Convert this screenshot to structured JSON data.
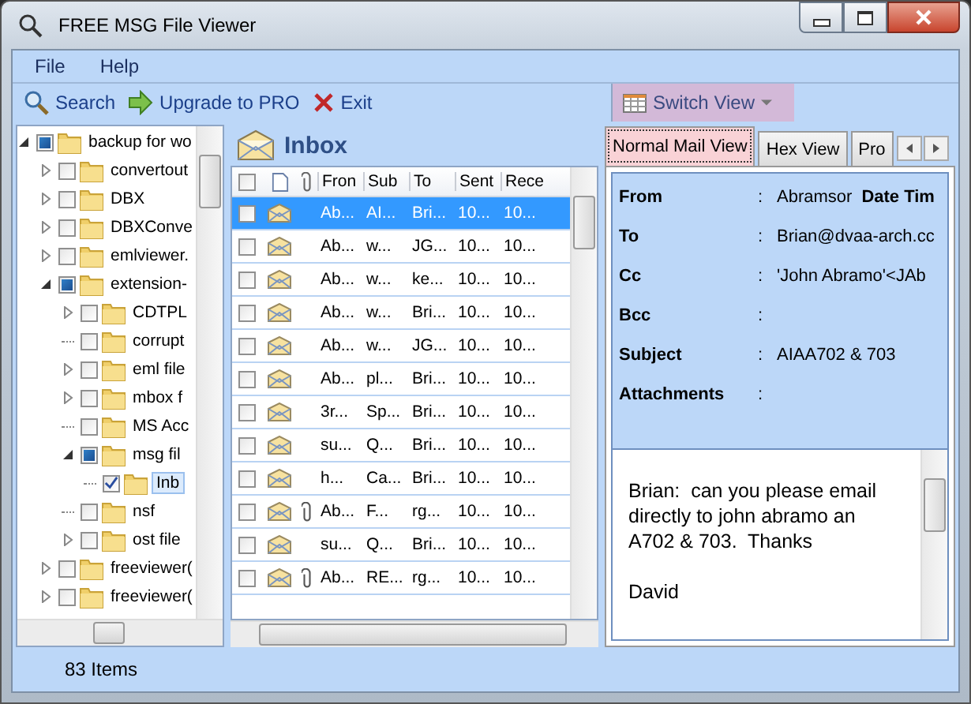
{
  "window": {
    "title": "FREE MSG File Viewer"
  },
  "menu": [
    "File",
    "Help"
  ],
  "toolbar": [
    {
      "kind": "search",
      "label": "Search",
      "highlighted": false
    },
    {
      "kind": "upgrade",
      "label": "Upgrade to PRO",
      "highlighted": false
    },
    {
      "kind": "exit",
      "label": "Exit",
      "highlighted": false
    },
    {
      "kind": "switch",
      "label": "Switch View",
      "highlighted": true
    }
  ],
  "tree": {
    "items": [
      {
        "label": "backup for wo",
        "checked": false,
        "partial": true,
        "expanded": true,
        "selected": false,
        "children": [
          {
            "label": "convertout",
            "checked": false,
            "partial": false,
            "expanded": false,
            "selected": false
          },
          {
            "label": "DBX",
            "checked": false,
            "partial": false,
            "expanded": false,
            "selected": false
          },
          {
            "label": "DBXConve",
            "checked": false,
            "partial": false,
            "expanded": false,
            "selected": false
          },
          {
            "label": "emlviewer.",
            "checked": false,
            "partial": false,
            "expanded": false,
            "selected": false
          },
          {
            "label": "extension-",
            "checked": false,
            "partial": true,
            "expanded": true,
            "selected": false,
            "children": [
              {
                "label": "CDTPL",
                "checked": false,
                "partial": false,
                "expanded": false,
                "selected": false
              },
              {
                "label": "corrupt",
                "checked": false,
                "partial": false,
                "selected": false
              },
              {
                "label": "eml file",
                "checked": false,
                "partial": false,
                "expanded": false,
                "selected": false
              },
              {
                "label": "mbox f",
                "checked": false,
                "partial": false,
                "expanded": false,
                "selected": false
              },
              {
                "label": "MS Acc",
                "checked": false,
                "partial": false,
                "selected": false
              },
              {
                "label": "msg fil",
                "checked": false,
                "partial": true,
                "expanded": true,
                "selected": false,
                "children": [
                  {
                    "label": "Inb",
                    "checked": true,
                    "selected": true
                  }
                ]
              },
              {
                "label": "nsf",
                "checked": false,
                "partial": false,
                "selected": false
              },
              {
                "label": "ost file",
                "checked": false,
                "partial": false,
                "expanded": false,
                "selected": false
              }
            ]
          },
          {
            "label": "freeviewer(",
            "checked": false,
            "partial": false,
            "expanded": false,
            "selected": false
          },
          {
            "label": "freeviewer(",
            "checked": false,
            "partial": false,
            "expanded": false,
            "selected": false
          }
        ]
      }
    ]
  },
  "inbox": {
    "title": "Inbox",
    "all_checked": false,
    "columns": [
      "Fron",
      "Sub",
      "To",
      "Sent",
      "Rece"
    ],
    "rows": [
      {
        "selected": true,
        "checked": false,
        "attachment": false,
        "cells": [
          "Ab...",
          "AI...",
          "Bri...",
          "10...",
          "10..."
        ]
      },
      {
        "selected": false,
        "checked": false,
        "attachment": false,
        "cells": [
          "Ab...",
          "w...",
          "JG...",
          "10...",
          "10..."
        ]
      },
      {
        "selected": false,
        "checked": false,
        "attachment": false,
        "cells": [
          "Ab...",
          "w...",
          "ke...",
          "10...",
          "10..."
        ]
      },
      {
        "selected": false,
        "checked": false,
        "attachment": false,
        "cells": [
          "Ab...",
          "w...",
          "Bri...",
          "10...",
          "10..."
        ]
      },
      {
        "selected": false,
        "checked": false,
        "attachment": false,
        "cells": [
          "Ab...",
          "w...",
          "JG...",
          "10...",
          "10..."
        ]
      },
      {
        "selected": false,
        "checked": false,
        "attachment": false,
        "cells": [
          "Ab...",
          "pl...",
          "Bri...",
          "10...",
          "10..."
        ]
      },
      {
        "selected": false,
        "checked": false,
        "attachment": false,
        "cells": [
          "3r...",
          "Sp...",
          "Bri...",
          "10...",
          "10..."
        ]
      },
      {
        "selected": false,
        "checked": false,
        "attachment": false,
        "cells": [
          "su...",
          "Q...",
          "Bri...",
          "10...",
          "10..."
        ]
      },
      {
        "selected": false,
        "checked": false,
        "attachment": false,
        "cells": [
          "h...",
          "Ca...",
          "Bri...",
          "10...",
          "10..."
        ]
      },
      {
        "selected": false,
        "checked": false,
        "attachment": true,
        "cells": [
          "Ab...",
          "F...",
          "rg...",
          "10...",
          "10..."
        ]
      },
      {
        "selected": false,
        "checked": false,
        "attachment": false,
        "cells": [
          "su...",
          "Q...",
          "Bri...",
          "10...",
          "10..."
        ]
      },
      {
        "selected": false,
        "checked": false,
        "attachment": true,
        "cells": [
          "Ab...",
          "RE...",
          "rg...",
          "10...",
          "10..."
        ]
      }
    ]
  },
  "viewer": {
    "tabs": [
      {
        "label": "Normal Mail View",
        "selected": true
      },
      {
        "label": "Hex View",
        "selected": false
      },
      {
        "label": "Pro",
        "selected": false
      }
    ],
    "fields": [
      {
        "label": "From",
        "separator": ":",
        "value": "Abramsor",
        "extra_label": "Date Tim"
      },
      {
        "label": "To",
        "separator": ":",
        "value": "Brian@dvaa-arch.cc"
      },
      {
        "label": "Cc",
        "separator": ":",
        "value": "'John Abramo'<JAb"
      },
      {
        "label": "Bcc",
        "separator": ":"
      },
      {
        "label": "Subject",
        "separator": ":",
        "value": "AIAA702 & 703"
      },
      {
        "label": "Attachments",
        "separator": ":"
      }
    ],
    "body": [
      [
        "Brian:  can you please email",
        "directly to john abramo an",
        "A702 & 703.  Thanks"
      ],
      [
        "David"
      ]
    ]
  },
  "status_bar": {
    "text": "83 Items"
  }
}
